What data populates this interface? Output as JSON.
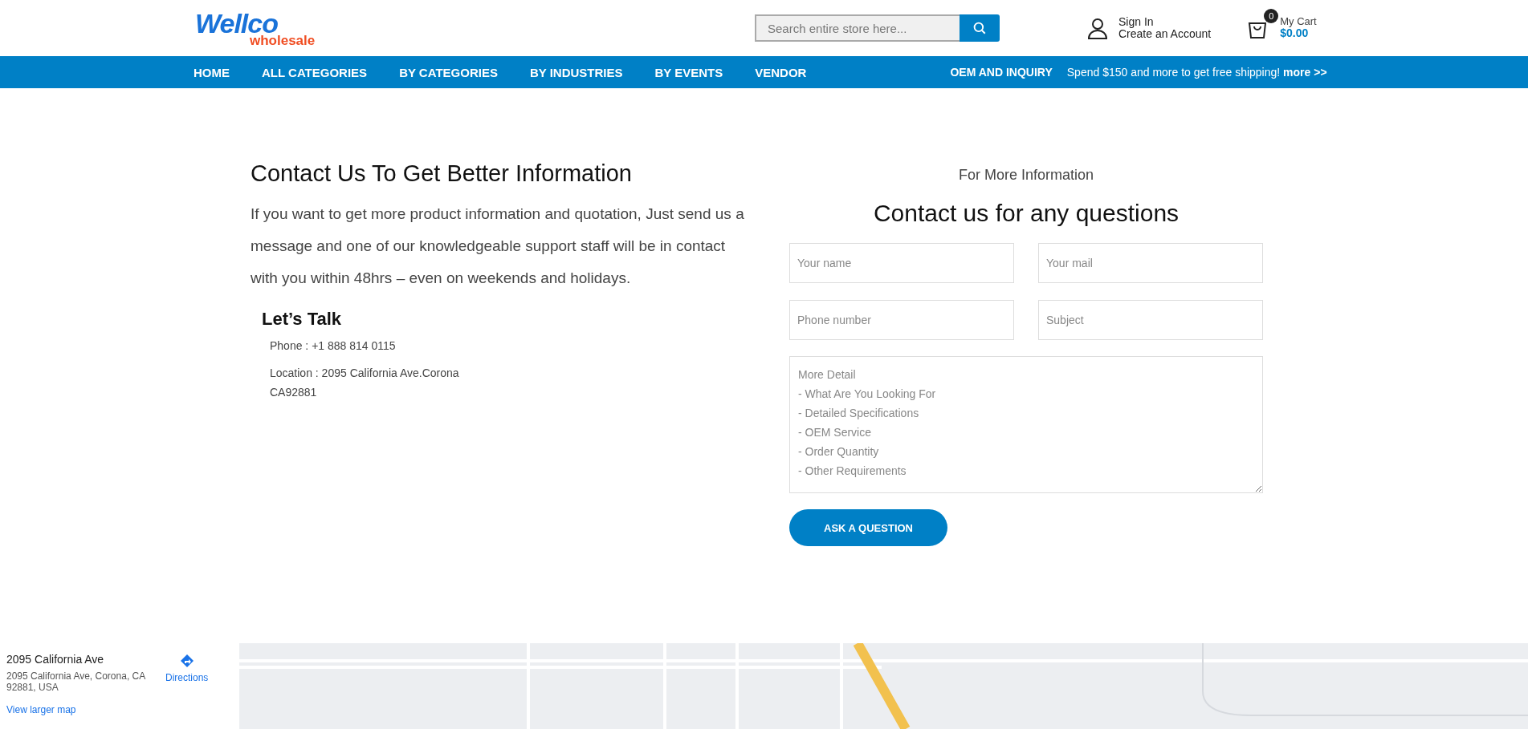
{
  "header": {
    "logo": {
      "top": "Wellco",
      "bottom": "wholesale"
    },
    "search": {
      "placeholder": "Search entire store here..."
    },
    "account": {
      "sign_in": "Sign In",
      "create": "Create an Account"
    },
    "cart": {
      "count": "0",
      "label": "My Cart",
      "total": "$0.00"
    }
  },
  "nav": {
    "items": [
      "HOME",
      "ALL CATEGORIES",
      "BY CATEGORIES",
      "BY INDUSTRIES",
      "BY EVENTS",
      "VENDOR"
    ],
    "right": "OEM AND INQUIRY",
    "promo": "Spend $150 and more to get free shipping! **more >>**"
  },
  "intro": {
    "title": "Contact Us To Get Better Information",
    "text": "If you want to get more product information and quotation, Just send us a message and one of our knowledgeable support staff will be in contact with you within 48hrs – even on weekends and holidays.",
    "talk_title": "Let’s Talk",
    "phone": "Phone : +1 888 814 0115",
    "location": [
      "Location : 2095 California Ave.Corona",
      "CA92881"
    ]
  },
  "form": {
    "eyebrow": "For More Information",
    "title": "Contact us for any questions",
    "fields": [
      {
        "placeholder": "Your name"
      },
      {
        "placeholder": "Your mail"
      },
      {
        "placeholder": "Phone number"
      },
      {
        "placeholder": "Subject"
      }
    ],
    "message": {
      "placeholder": "More Detail\n- What Are You Looking For\n- Detailed Specifications\n- OEM Service\n- Order Quantity\n- Other Requirements"
    },
    "submit": "ASK A QUESTION"
  },
  "map": {
    "place": "2095 California Ave",
    "address": "2095 California Ave, Corona, CA 92881, USA",
    "directions": "Directions",
    "larger": "View larger map"
  }
}
